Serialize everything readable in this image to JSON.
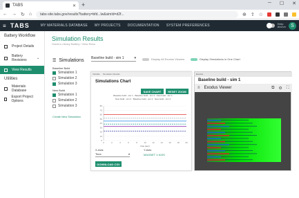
{
  "browser": {
    "tab_title": "TABS",
    "url": "tabs-site.tabs.gov/results?battery=bfd...lw&simId=d2f...",
    "new_tab": "+"
  },
  "appbar": {
    "logo": "TABS",
    "nav": [
      "MY MATERIALS DATABASE",
      "MY PROJECTS",
      "DOCUMENTATION",
      "SYSTEM PREFERENCES"
    ],
    "help": "Help",
    "help2": "Above",
    "avatar": "S"
  },
  "sidebar": {
    "header": "Battery Workflow",
    "items": [
      {
        "label": "Project Details",
        "icon": "document-icon"
      },
      {
        "label": "Battery Revisions",
        "icon": "battery-icon"
      },
      {
        "label": "View Results",
        "icon": "chart-icon",
        "active": true
      }
    ],
    "utilities_header": "Utilities",
    "utilities": [
      {
        "label": "Materials Database",
        "icon": "database-icon"
      },
      {
        "label": "Export Project Options",
        "icon": "export-icon"
      }
    ]
  },
  "page": {
    "title": "Simulation Results",
    "breadcrumb": "Guide's Library Battery / View Resu"
  },
  "simulations": {
    "heading": "Simulations",
    "groups": [
      {
        "label": "Baseline Build",
        "items": [
          {
            "label": "Simulation 1",
            "checked": true
          },
          {
            "label": "Simulation 2",
            "checked": false
          },
          {
            "label": "Simulation 3",
            "checked": true
          }
        ]
      },
      {
        "label": "New Build",
        "items": [
          {
            "label": "Simulation 1",
            "checked": true
          },
          {
            "label": "Simulation 2",
            "checked": false
          },
          {
            "label": "Simulation 3",
            "checked": false
          }
        ]
      }
    ],
    "create_new": "Create New Simulation"
  },
  "controls": {
    "baseline_select": "Baseline build - sim 1",
    "display_all": "Display All Exodus Viewers",
    "display_one": "Display Simulations in One Chart"
  },
  "chart_panel": {
    "tabs": [
      "Variable",
      "Simulation Results"
    ],
    "title": "Simulations Chart",
    "save_btn": "SAVE CHART",
    "reset_btn": "RESET ZOOM",
    "legend": [
      "Baseline build - sim 1",
      "Baseline build - sim 3",
      "New build - sim 1",
      "New build - sim 2",
      "Baseline build - sim 2",
      "New build - sim 3"
    ],
    "xaxis_label": "X-Axis",
    "xaxis_value": "Time",
    "yaxis_label": "Y-Axis",
    "yaxis_value": "MAGNET V AXIS",
    "download": "DOWNLOAD CSV"
  },
  "chart_data": {
    "type": "line",
    "xlim": [
      0,
      20
    ],
    "ylim": [
      0,
      80
    ],
    "x_ticks": [
      "0",
      "2",
      "4",
      "6",
      "8",
      "10",
      "12",
      "14",
      "16",
      "18",
      "20"
    ],
    "y_ticks": [
      "0",
      "10",
      "20",
      "30",
      "40",
      "50",
      "60",
      "70",
      "80"
    ],
    "xlabel": "time (sec)",
    "series": [
      {
        "color": "#e53935",
        "values": [
          60,
          60
        ]
      },
      {
        "color": "#b0bec5",
        "values": [
          52,
          52
        ]
      },
      {
        "color": "#1e88e5",
        "values": [
          45,
          45
        ]
      },
      {
        "color": "#26a69a",
        "values": [
          38,
          38
        ]
      },
      {
        "color": "#8e24aa",
        "values": [
          33,
          33
        ]
      },
      {
        "color": "#3949ab",
        "values": [
          22,
          22
        ]
      }
    ]
  },
  "viewer_panel": {
    "top_label": "Exodus",
    "title": "Baseline build - sim 1",
    "heading": "Exodus Viewer"
  },
  "colors": {
    "accent": "#1e8e6e",
    "appbar": "#1f2a33"
  }
}
